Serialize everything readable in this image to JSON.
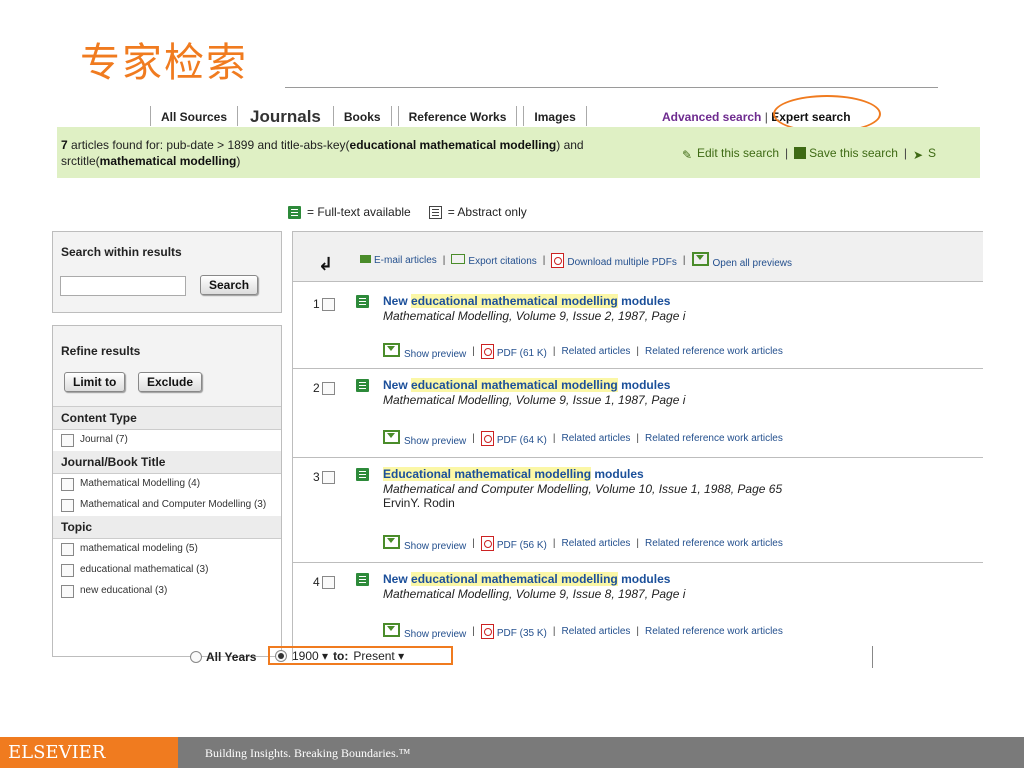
{
  "slide_title": "专家检索",
  "tabs": [
    "All Sources",
    "Journals",
    "Books",
    "Reference Works",
    "Images"
  ],
  "advanced_search": "Advanced search",
  "expert_search": "Expert search",
  "summary": {
    "count": "7",
    "pre": " articles found for: pub-date > 1899 and title-abs-key(",
    "kw1": "educational mathematical modelling",
    "mid": ") and srctitle(",
    "kw2": "mathematical modelling",
    "post": ")"
  },
  "edit_links": [
    "Edit this search",
    "Save this search",
    "S"
  ],
  "legend": {
    "fulltext": "= Full-text available",
    "abstract": "= Abstract only"
  },
  "search_within": {
    "title": "Search within results",
    "button": "Search",
    "value": ""
  },
  "refine": {
    "title": "Refine results",
    "limit": "Limit to",
    "exclude": "Exclude",
    "sections": [
      {
        "title": "Content Type",
        "items": [
          "Journal (7)"
        ]
      },
      {
        "title": "Journal/Book Title",
        "items": [
          "Mathematical Modelling (4)",
          "Mathematical and Computer Modelling (3)"
        ]
      },
      {
        "title": "Topic",
        "items": [
          "mathematical modeling (5)",
          "educational mathematical (3)",
          "new educational (3)"
        ]
      }
    ]
  },
  "toolbar": [
    "E-mail articles",
    "Export citations",
    "Download multiple PDFs",
    "Open all previews"
  ],
  "results": [
    {
      "num": "1",
      "title_pre": "New ",
      "title_hl": "educational mathematical modelling",
      "title_post": " modules",
      "src": "Mathematical Modelling, Volume 9, Issue 2, 1987, Page i",
      "author": "",
      "pdf": "PDF (61 K)"
    },
    {
      "num": "2",
      "title_pre": "New ",
      "title_hl": "educational mathematical modelling",
      "title_post": " modules",
      "src": "Mathematical Modelling, Volume 9, Issue 1, 1987, Page i",
      "author": "",
      "pdf": "PDF (64 K)"
    },
    {
      "num": "3",
      "title_pre": "",
      "title_hl": "Educational mathematical modelling",
      "title_post": " modules",
      "src": "Mathematical and Computer Modelling, Volume 10, Issue 1, 1988, Page 65",
      "author": "ErvinY. Rodin",
      "pdf": "PDF (56 K)"
    },
    {
      "num": "4",
      "title_pre": "New ",
      "title_hl": "educational mathematical modelling",
      "title_post": " modules",
      "src": "Mathematical Modelling, Volume 9, Issue 8, 1987, Page i",
      "author": "",
      "pdf": "PDF (35 K)"
    }
  ],
  "result_links": {
    "preview": "Show preview",
    "related": "Related articles",
    "related_ref": "Related reference work articles"
  },
  "years": {
    "all": "All Years",
    "from": "1900",
    "to_label": "to:",
    "to": "Present"
  },
  "footer": {
    "brand": "ELSEVIER",
    "tagline": "Building Insights. Breaking Boundaries.™"
  }
}
